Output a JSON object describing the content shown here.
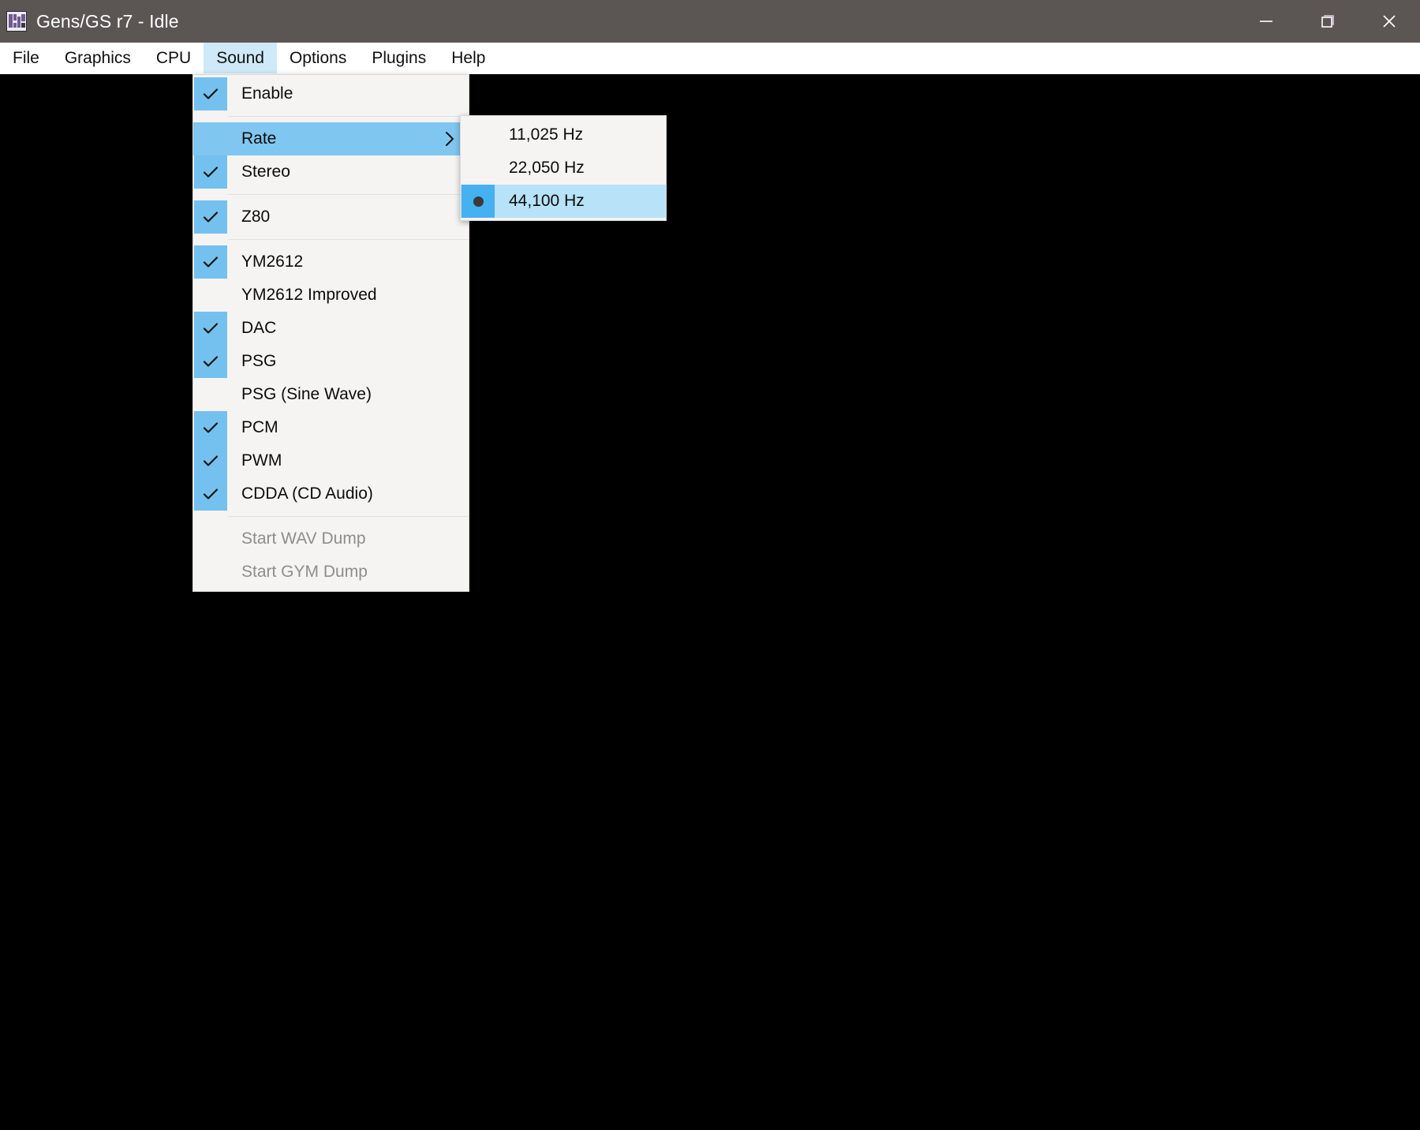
{
  "window": {
    "title": "Gens/GS r7 - Idle",
    "icon": "app-icon",
    "controls": {
      "minimize": "minimize",
      "restore": "restore",
      "close": "close"
    }
  },
  "menubar": {
    "items": [
      {
        "label": "File",
        "active": false
      },
      {
        "label": "Graphics",
        "active": false
      },
      {
        "label": "CPU",
        "active": false
      },
      {
        "label": "Sound",
        "active": true
      },
      {
        "label": "Options",
        "active": false
      },
      {
        "label": "Plugins",
        "active": false
      },
      {
        "label": "Help",
        "active": false
      }
    ]
  },
  "sound_menu": {
    "items": [
      {
        "label": "Enable",
        "checked": true,
        "enabled": true,
        "highlight": false,
        "submenu": false
      },
      {
        "separator": true
      },
      {
        "label": "Rate",
        "checked": false,
        "enabled": true,
        "highlight": true,
        "submenu": true
      },
      {
        "label": "Stereo",
        "checked": true,
        "enabled": true,
        "highlight": false,
        "submenu": false
      },
      {
        "separator": true
      },
      {
        "label": "Z80",
        "checked": true,
        "enabled": true,
        "highlight": false,
        "submenu": false
      },
      {
        "separator": true
      },
      {
        "label": "YM2612",
        "checked": true,
        "enabled": true,
        "highlight": false,
        "submenu": false
      },
      {
        "label": "YM2612 Improved",
        "checked": false,
        "enabled": true,
        "highlight": false,
        "submenu": false
      },
      {
        "label": "DAC",
        "checked": true,
        "enabled": true,
        "highlight": false,
        "submenu": false
      },
      {
        "label": "PSG",
        "checked": true,
        "enabled": true,
        "highlight": false,
        "submenu": false
      },
      {
        "label": "PSG (Sine Wave)",
        "checked": false,
        "enabled": true,
        "highlight": false,
        "submenu": false
      },
      {
        "label": "PCM",
        "checked": true,
        "enabled": true,
        "highlight": false,
        "submenu": false
      },
      {
        "label": "PWM",
        "checked": true,
        "enabled": true,
        "highlight": false,
        "submenu": false
      },
      {
        "label": "CDDA (CD Audio)",
        "checked": true,
        "enabled": true,
        "highlight": false,
        "submenu": false
      },
      {
        "separator": true
      },
      {
        "label": "Start WAV Dump",
        "checked": false,
        "enabled": false,
        "highlight": false,
        "submenu": false
      },
      {
        "label": "Start GYM Dump",
        "checked": false,
        "enabled": false,
        "highlight": false,
        "submenu": false
      }
    ]
  },
  "rate_submenu": {
    "items": [
      {
        "label": "11,025 Hz",
        "selected": false
      },
      {
        "label": "22,050 Hz",
        "selected": false
      },
      {
        "label": "44,100 Hz",
        "selected": true
      }
    ]
  },
  "colors": {
    "titlebar": "#5b5653",
    "menubar": "#ffffff",
    "menu_bg": "#f5f4f3",
    "highlight": "#7fc6f0",
    "selected_row": "#b7e2f7",
    "check_box": "#74c0ee",
    "radio_box": "#45b1f0",
    "viewport": "#000000",
    "disabled_text": "#8d8d8d",
    "menubar_active": "#cfe9f8"
  }
}
